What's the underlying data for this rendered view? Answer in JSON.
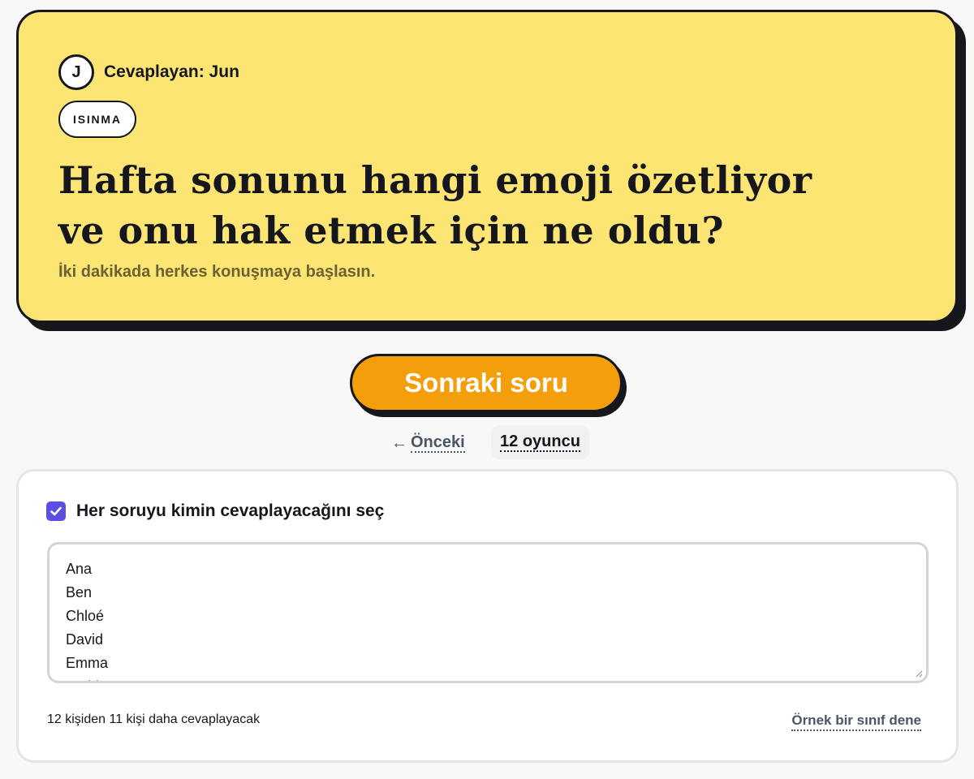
{
  "question_card": {
    "answerer_initial": "J",
    "answerer_label": "Cevaplayan: Jun",
    "category_tag": "ISINMA",
    "question_line1": "Hafta sonunu hangi emoji özetliyor",
    "question_line2": "ve onu hak etmek için ne oldu?",
    "subtitle": "İki dakikada herkes konuşmaya başlasın.",
    "background_color": "#fde574"
  },
  "next_button": {
    "label": "Sonraki soru",
    "color": "#f59e0b"
  },
  "nav": {
    "prev_label": "Önceki",
    "prev_icon": "arrow-left-icon",
    "players_count_label": "12 oyuncu"
  },
  "settings": {
    "pick_answerer_label": "Her soruyu kimin cevaplayacağını seç",
    "pick_answerer_checked": true,
    "players": [
      "Ana",
      "Ben",
      "Chloé",
      "David",
      "Emma",
      "Farid"
    ],
    "remaining_text": "12 kişiden 11 kişi daha cevaplayacak",
    "sample_class_link": "Örnek bir sınıf dene",
    "checkbox_color": "#5b4fe0"
  }
}
